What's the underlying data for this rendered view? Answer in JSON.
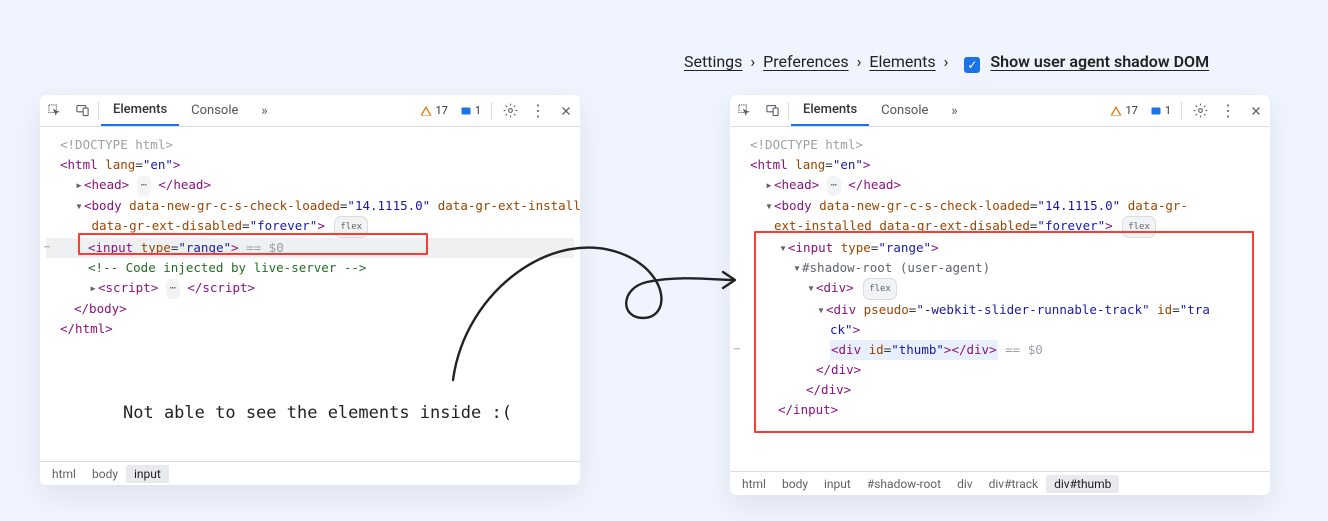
{
  "settingsPath": {
    "settings": "Settings",
    "preferences": "Preferences",
    "elements": "Elements",
    "checkboxLabel": "Show user agent shadow DOM"
  },
  "toolbar": {
    "tabElements": "Elements",
    "tabConsole": "Console",
    "warnings": "17",
    "info": "1"
  },
  "leftPanel": {
    "doctype": "<!DOCTYPE html>",
    "htmlOpen": "html",
    "lang": "lang",
    "langVal": "\"en\"",
    "head": "head",
    "body": "body",
    "attr1n": "data-new-gr-c-s-check-loaded",
    "attr1v": "\"14.1115.0\"",
    "attr2n": "data-gr-ext-installed",
    "attr3n": "data-gr-ext-disabled",
    "attr3v": "\"forever\"",
    "flex": "flex",
    "inputOpen": "input",
    "typeAttr": "type",
    "typeVal": "\"range\"",
    "eq": "== $0",
    "comment": "<!-- Code injected by live-server -->",
    "script": "script",
    "bodyClose": "</body>",
    "htmlClose": "</html>",
    "caption": "Not able to see the elements inside :(",
    "breadcrumbs": [
      "html",
      "body",
      "input"
    ]
  },
  "rightPanel": {
    "shadowRoot": "#shadow-root (user-agent)",
    "div": "div",
    "pseudo": "pseudo",
    "pseudoVal": "\"-webkit-slider-runnable-track\"",
    "idAttr": "id",
    "trackVal": "\"track\"",
    "thumbVal": "\"thumb\"",
    "inputClose": "</input>",
    "divClose": "</div>",
    "breadcrumbs": [
      "html",
      "body",
      "input",
      "#shadow-root",
      "div",
      "div#track",
      "div#thumb"
    ]
  }
}
